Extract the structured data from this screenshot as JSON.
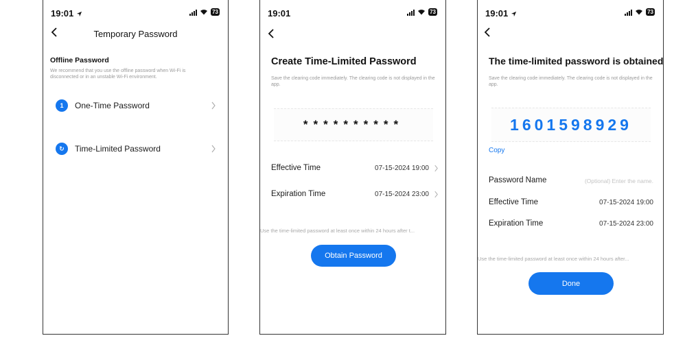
{
  "phone1": {
    "status_time": "19:01",
    "battery": "73",
    "title": "Temporary Password",
    "section_title": "Offline Password",
    "section_desc": "We recommend that you use the offline password when Wi-Fi is disconnected or in an unstable Wi-Fi environment.",
    "items": [
      {
        "badge": "1",
        "label": "One-Time Password"
      },
      {
        "badge": "↻",
        "label": "Time-Limited Password"
      }
    ]
  },
  "phone2": {
    "status_time": "19:01",
    "battery": "73",
    "heading": "Create Time-Limited Password",
    "desc": "Save the clearing code immediately. The clearing code is not displayed in the app.",
    "masked_password": "**********",
    "effective_label": "Effective Time",
    "effective_value": "07-15-2024 19:00",
    "expiration_label": "Expiration Time",
    "expiration_value": "07-15-2024 23:00",
    "note": "Use the time-limited password at least once within 24 hours after t...",
    "button": "Obtain Password"
  },
  "phone3": {
    "status_time": "19:01",
    "battery": "73",
    "heading": "The time-limited password is obtained.",
    "desc": "Save the clearing code immediately. The clearing code is not displayed in the app.",
    "password": "1601598929",
    "copy": "Copy",
    "name_label": "Password Name",
    "name_placeholder": "(Optional) Enter the name.",
    "effective_label": "Effective Time",
    "effective_value": "07-15-2024 19:00",
    "expiration_label": "Expiration Time",
    "expiration_value": "07-15-2024 23:00",
    "note": "Use the time-limited password at least once within 24 hours after...",
    "button": "Done"
  },
  "colors": {
    "accent": "#1577ee"
  }
}
